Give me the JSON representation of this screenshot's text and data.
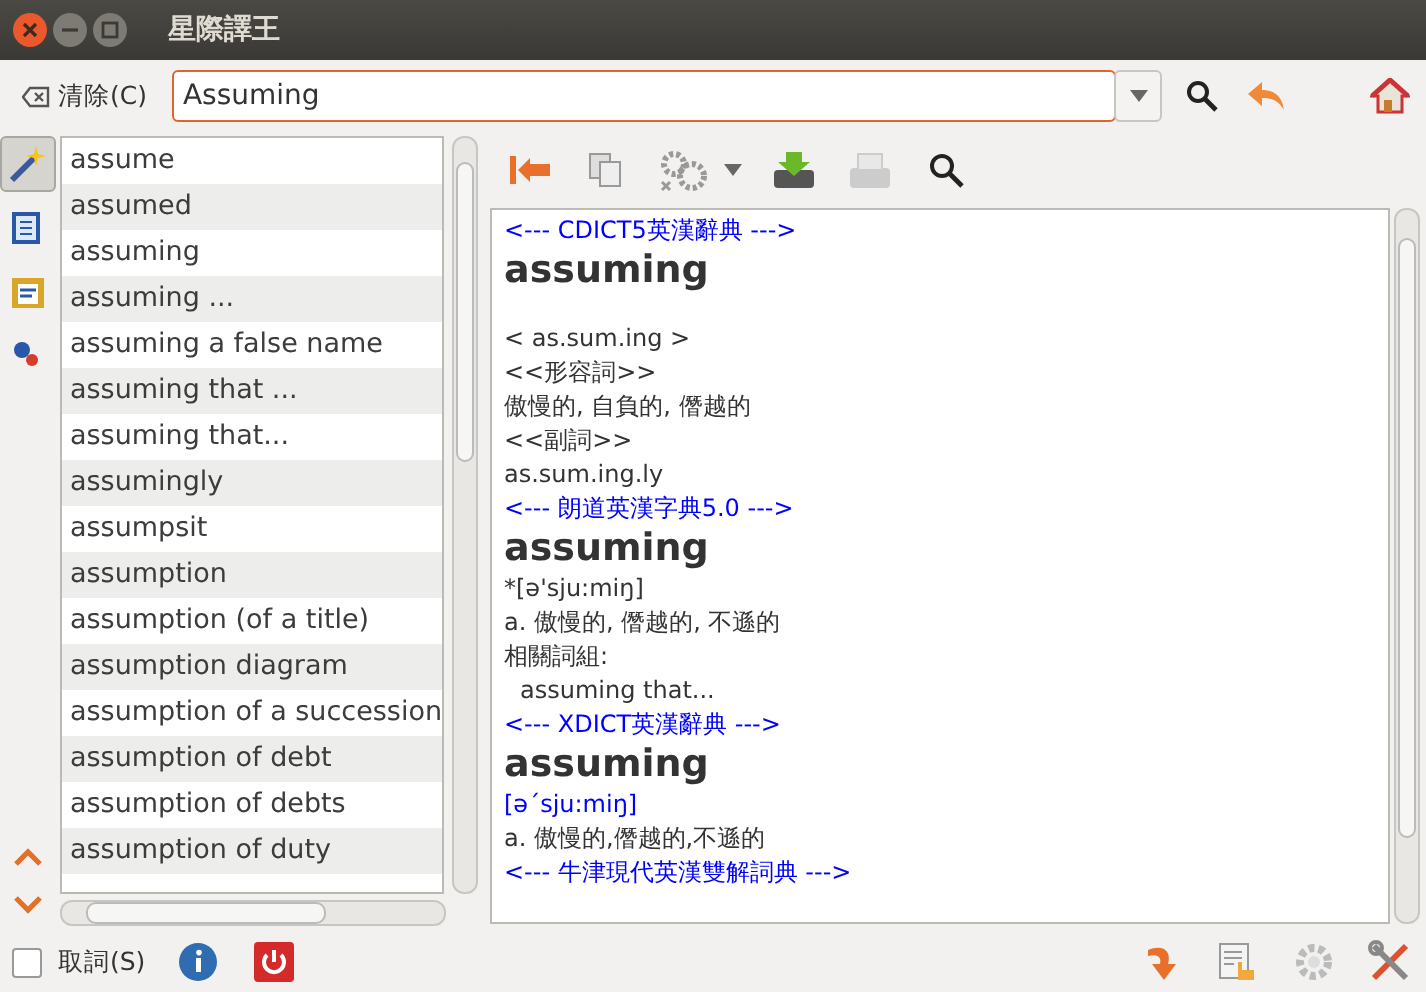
{
  "window": {
    "title": "星際譯王"
  },
  "toolbar": {
    "clear_label": "清除(C)",
    "search": {
      "value": "Assuming"
    }
  },
  "side_tools": [
    {
      "selected": true
    },
    {
      "selected": false
    },
    {
      "selected": false
    },
    {
      "selected": false
    }
  ],
  "word_list": [
    {
      "text": "assume"
    },
    {
      "text": "assumed"
    },
    {
      "text": "assuming"
    },
    {
      "text": "assuming ..."
    },
    {
      "text": "assuming a false name"
    },
    {
      "text": "assuming that ..."
    },
    {
      "text": "assuming that..."
    },
    {
      "text": "assumingly"
    },
    {
      "text": "assumpsit"
    },
    {
      "text": "assumption"
    },
    {
      "text": "assumption (of a title)"
    },
    {
      "text": "assumption diagram"
    },
    {
      "text": "assumption of a succession"
    },
    {
      "text": "assumption of debt"
    },
    {
      "text": "assumption of debts"
    },
    {
      "text": "assumption of duty"
    }
  ],
  "definition": [
    {
      "kind": "header",
      "text": "<--- CDICT5英漢辭典 --->"
    },
    {
      "kind": "headword",
      "text": "assuming"
    },
    {
      "kind": "blank"
    },
    {
      "kind": "line",
      "text": "< as.sum.ing >"
    },
    {
      "kind": "line",
      "text": "<<形容詞>>"
    },
    {
      "kind": "line",
      "text": "傲慢的, 自負的, 僭越的"
    },
    {
      "kind": "line",
      "text": "<<副詞>>"
    },
    {
      "kind": "line",
      "text": "as.sum.ing.ly"
    },
    {
      "kind": "header",
      "text": "<--- 朗道英漢字典5.0 --->"
    },
    {
      "kind": "headword",
      "text": "assuming"
    },
    {
      "kind": "line",
      "text": "*[ə'sju:miŋ]"
    },
    {
      "kind": "line",
      "text": "a. 傲慢的, 僭越的, 不遜的"
    },
    {
      "kind": "line",
      "text": "相關詞組:"
    },
    {
      "kind": "indent",
      "text": "assuming that..."
    },
    {
      "kind": "header",
      "text": "<--- XDICT英漢辭典 --->"
    },
    {
      "kind": "headword",
      "text": "assuming"
    },
    {
      "kind": "phonetic",
      "text": "[əˊsju:miŋ]"
    },
    {
      "kind": "line",
      "text": "a. 傲慢的,僭越的,不遜的"
    },
    {
      "kind": "header",
      "text": "<--- 牛津現代英漢雙解詞典 --->"
    }
  ],
  "bottom_bar": {
    "scan_label": "取詞(S)",
    "scan_checked": false
  }
}
